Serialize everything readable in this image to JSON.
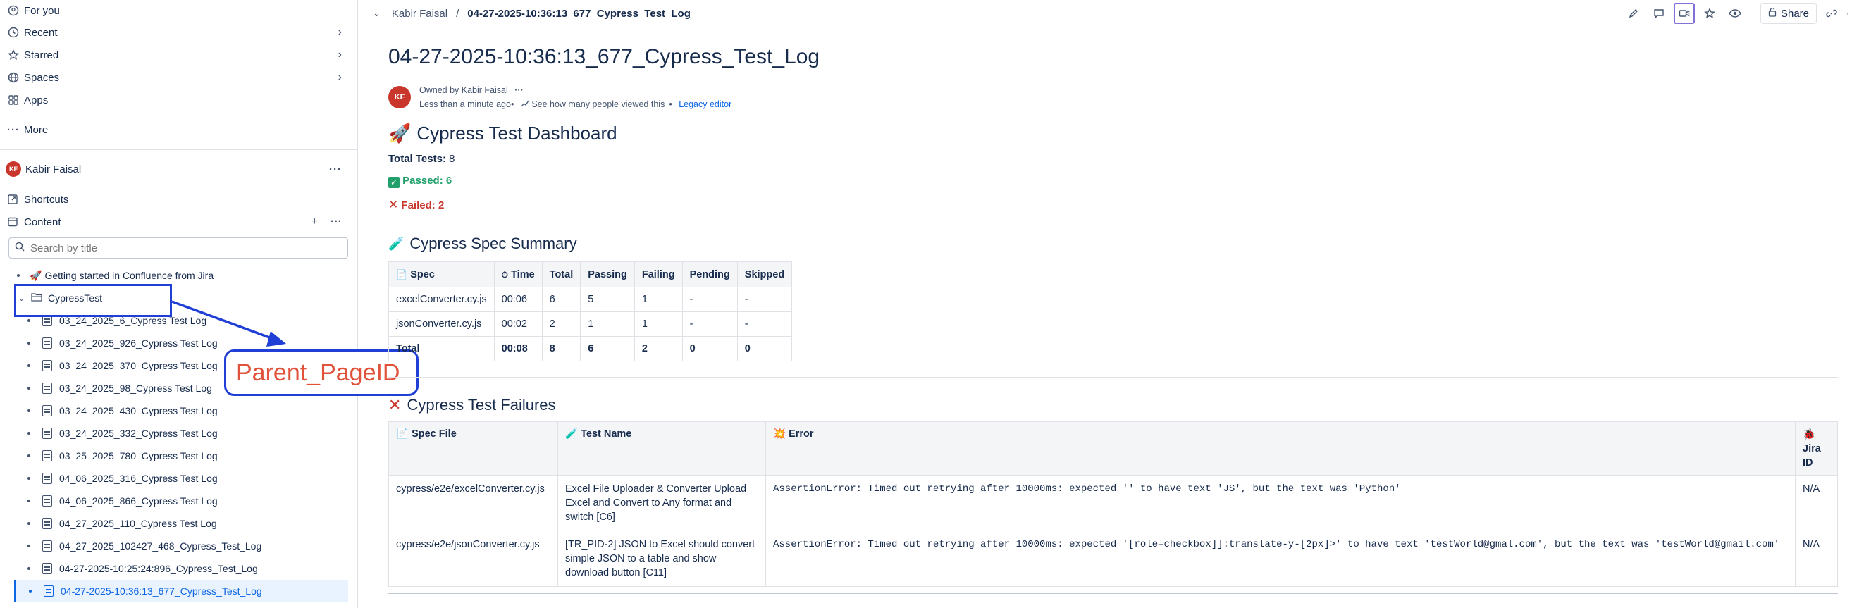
{
  "sidebar": {
    "nav": [
      {
        "label": "For you",
        "icon": "user-circle-icon"
      },
      {
        "label": "Recent",
        "icon": "clock-icon"
      },
      {
        "label": "Starred",
        "icon": "star-icon"
      },
      {
        "label": "Spaces",
        "icon": "globe-icon"
      },
      {
        "label": "Apps",
        "icon": "apps-icon"
      },
      {
        "label": "More",
        "icon": "more-dots-icon"
      }
    ],
    "space_name": "Kabir Faisal",
    "avatar_initials": "KF",
    "shortcuts_label": "Shortcuts",
    "content_label": "Content",
    "search_placeholder": "Search by title",
    "tree_top": "Getting started in Confluence from Jira",
    "folder": "CypressTest",
    "pages": [
      "03_24_2025_6_Cypress Test Log",
      "03_24_2025_926_Cypress Test Log",
      "03_24_2025_370_Cypress Test Log",
      "03_24_2025_98_Cypress Test Log",
      "03_24_2025_430_Cypress Test Log",
      "03_24_2025_332_Cypress Test Log",
      "03_25_2025_780_Cypress Test Log",
      "04_06_2025_316_Cypress Test Log",
      "04_06_2025_866_Cypress Test Log",
      "04_27_2025_110_Cypress Test Log",
      "04_27_2025_102427_468_Cypress_Test_Log",
      "04-27-2025-10:25:24:896_Cypress_Test_Log",
      "04-27-2025-10:36:13_677_Cypress_Test_Log"
    ]
  },
  "annotation": {
    "label": "Parent_PageID",
    "color": "#1f3fd6",
    "text_color": "#e0533a"
  },
  "breadcrumb": {
    "space": "Kabir Faisal",
    "separator": "/",
    "page": "04-27-2025-10:36:13_677_Cypress_Test_Log"
  },
  "toolbar": {
    "share": "Share"
  },
  "page": {
    "title": "04-27-2025-10:36:13_677_Cypress_Test_Log",
    "owned_by_prefix": "Owned by",
    "owner": "Kabir Faisal",
    "updated": "Less than a minute ago",
    "views": "See how many people viewed this",
    "legacy": "Legacy editor"
  },
  "dashboard": {
    "title": "Cypress Test Dashboard",
    "total_label": "Total Tests:",
    "total": "8",
    "passed_label": "Passed:",
    "passed": "6",
    "failed_label": "Failed:",
    "failed": "2"
  },
  "summary": {
    "title": "Cypress Spec Summary",
    "headers": [
      "Spec",
      "Time",
      "Total",
      "Passing",
      "Failing",
      "Pending",
      "Skipped"
    ],
    "rows": [
      [
        "excelConverter.cy.js",
        "00:06",
        "6",
        "5",
        "1",
        "-",
        "-"
      ],
      [
        "jsonConverter.cy.js",
        "00:02",
        "2",
        "1",
        "1",
        "-",
        "-"
      ]
    ],
    "total_row": [
      "Total",
      "00:08",
      "8",
      "6",
      "2",
      "0",
      "0"
    ]
  },
  "failures": {
    "title": "Cypress Test Failures",
    "headers": [
      "Spec File",
      "Test Name",
      "Error",
      "Jira ID"
    ],
    "rows": [
      [
        "cypress/e2e/excelConverter.cy.js",
        "Excel File Uploader & Converter Upload Excel and Convert to Any format and switch [C6]",
        "AssertionError: Timed out retrying after 10000ms: expected '' to have text 'JS', but the text was 'Python'",
        "N/A"
      ],
      [
        "cypress/e2e/jsonConverter.cy.js",
        "[TR_PID-2] JSON to Excel should convert simple JSON to a table and show download button [C11]",
        "AssertionError: Timed out retrying after 10000ms: expected '[role=checkbox]]:translate-y-[2px]>' to have text 'testWorld@gmal.com', but the text was 'testWorld@gmail.com'",
        "N/A"
      ]
    ]
  }
}
